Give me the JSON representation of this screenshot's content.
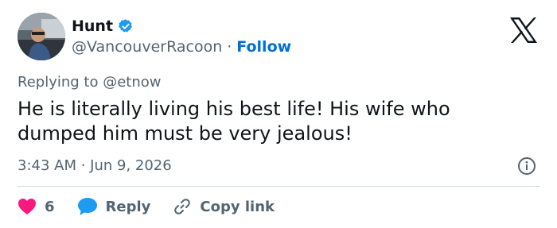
{
  "author": {
    "name": "Hunt",
    "handle": "@VancouverRacoon",
    "separator": "·",
    "follow_label": "Follow"
  },
  "icons": {
    "verified": "verified-badge-icon",
    "logo": "x-logo-icon",
    "info": "info-icon",
    "like": "heart-icon",
    "reply": "speech-bubble-icon",
    "copy": "link-icon"
  },
  "colors": {
    "accent": "#1d9bf0",
    "follow": "#006fd6",
    "like": "#f91880",
    "muted": "#536471",
    "text": "#0f1419"
  },
  "tweet": {
    "replying_to": "Replying to @etnow",
    "text": "He is literally living his best life! His wife who dumped him must be very jealous!",
    "timestamp": "3:43 AM · Jun 9, 2026"
  },
  "actions": {
    "like_count": "6",
    "reply_label": "Reply",
    "copy_label": "Copy link"
  }
}
